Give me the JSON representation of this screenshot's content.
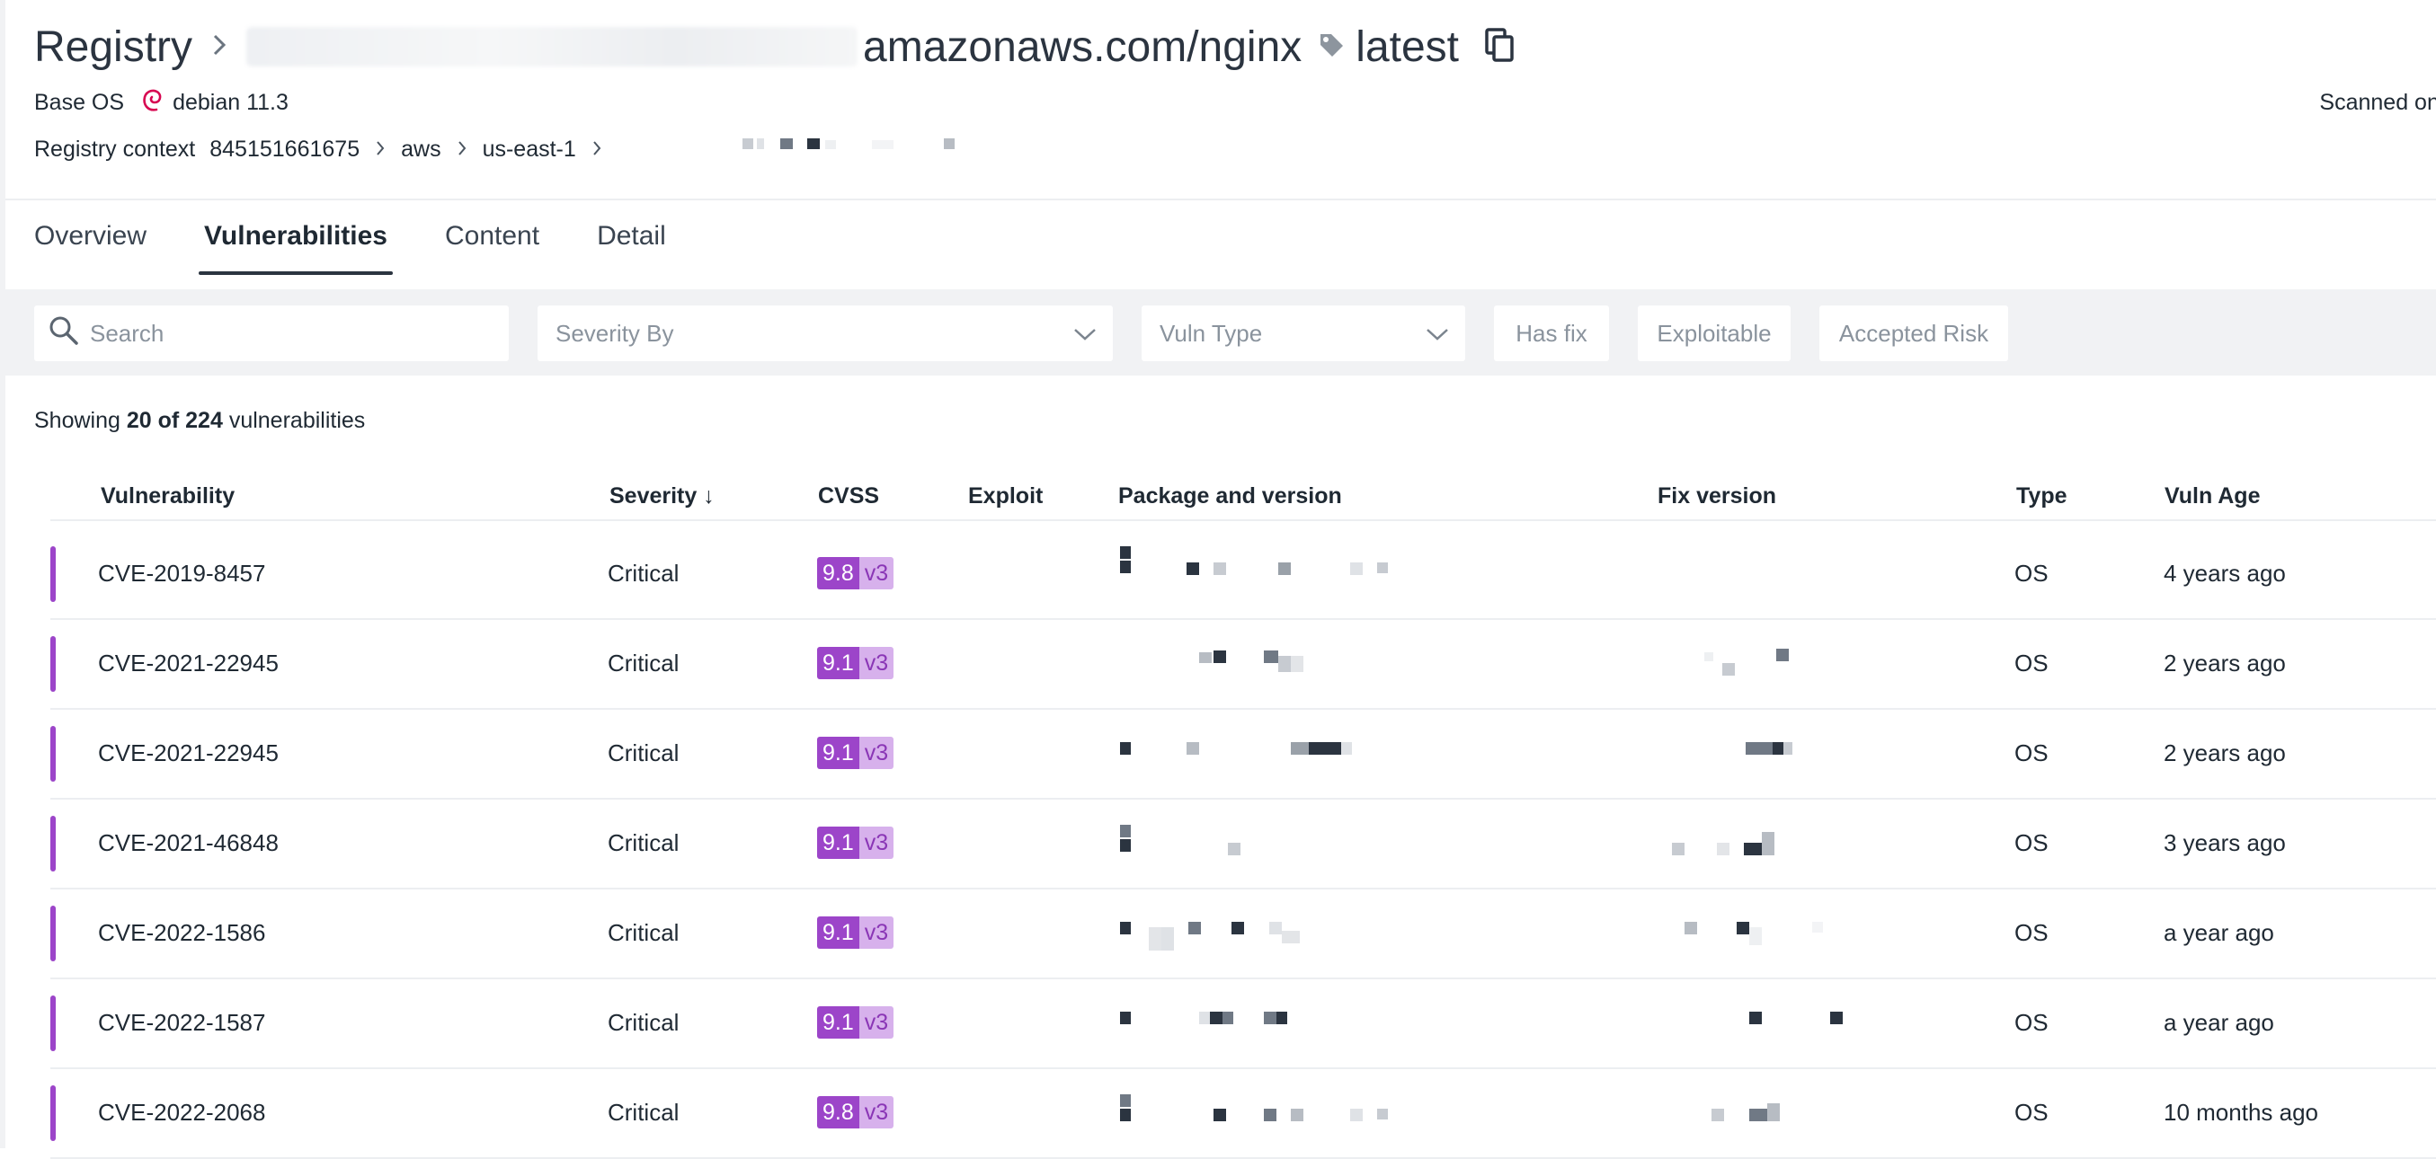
{
  "header": {
    "breadcrumb_root": "Registry",
    "repo_suffix": "amazonaws.com/nginx",
    "tag": "latest",
    "base_os_label": "Base OS",
    "base_os_value": "debian 11.3",
    "scanned_text": "Scanned on Ap",
    "registry_context_label": "Registry context",
    "context_path": [
      "845151661675",
      "aws",
      "us-east-1"
    ]
  },
  "tabs": [
    "Overview",
    "Vulnerabilities",
    "Content",
    "Detail"
  ],
  "active_tab": "Vulnerabilities",
  "filters": {
    "search_placeholder": "Search",
    "severity_placeholder": "Severity By",
    "vuln_type_placeholder": "Vuln Type",
    "has_fix": "Has fix",
    "exploitable": "Exploitable",
    "accepted_risk": "Accepted Risk"
  },
  "summary": {
    "prefix": "Showing ",
    "count": "20 of 224",
    "suffix": " vulnerabilities"
  },
  "table": {
    "columns": {
      "vulnerability": "Vulnerability",
      "severity": "Severity ↓",
      "cvss": "CVSS",
      "exploit": "Exploit",
      "package": "Package and version",
      "fix": "Fix version",
      "type": "Type",
      "age": "Vuln Age"
    },
    "rows": [
      {
        "id": "CVE-2019-8457",
        "severity": "Critical",
        "score": "9.8",
        "version": "v3",
        "type": "OS",
        "age": "4 years ago"
      },
      {
        "id": "CVE-2021-22945",
        "severity": "Critical",
        "score": "9.1",
        "version": "v3",
        "type": "OS",
        "age": "2 years ago"
      },
      {
        "id": "CVE-2021-22945",
        "severity": "Critical",
        "score": "9.1",
        "version": "v3",
        "type": "OS",
        "age": "2 years ago"
      },
      {
        "id": "CVE-2021-46848",
        "severity": "Critical",
        "score": "9.1",
        "version": "v3",
        "type": "OS",
        "age": "3 years ago"
      },
      {
        "id": "CVE-2022-1586",
        "severity": "Critical",
        "score": "9.1",
        "version": "v3",
        "type": "OS",
        "age": "a year ago"
      },
      {
        "id": "CVE-2022-1587",
        "severity": "Critical",
        "score": "9.1",
        "version": "v3",
        "type": "OS",
        "age": "a year ago"
      },
      {
        "id": "CVE-2022-2068",
        "severity": "Critical",
        "score": "9.8",
        "version": "v3",
        "type": "OS",
        "age": "10 months ago"
      }
    ]
  },
  "colors": {
    "critical": "#9c45c9",
    "cvss_version_bg": "#d7b1ec",
    "filter_band": "#f1f2f4"
  }
}
